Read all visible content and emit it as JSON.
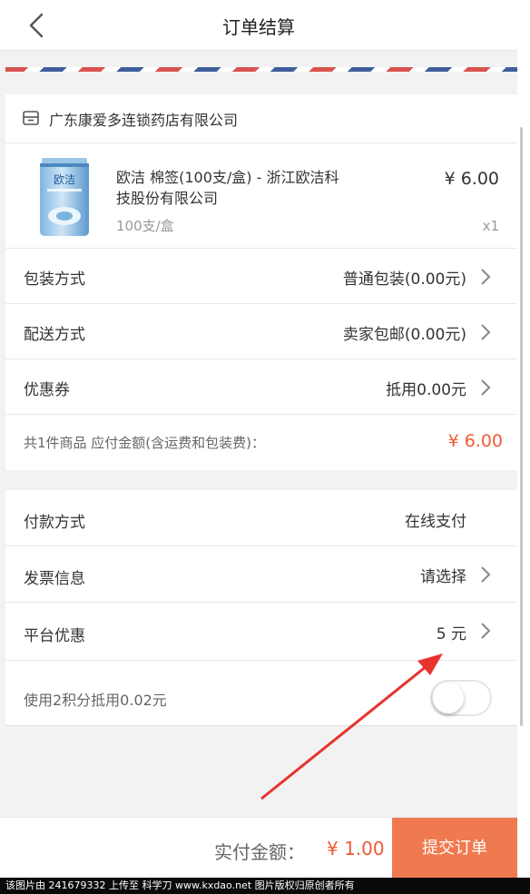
{
  "header": {
    "title": "订单结算"
  },
  "store": {
    "name": "广东康爱多连锁药店有限公司"
  },
  "product": {
    "name": "欧洁 棉签(100支/盒) - 浙江欧洁科技股份有限公司",
    "name_line1": "欧洁 棉签(100支/盒) - 浙江欧洁科",
    "name_line2": "技股份有限公司",
    "spec": "100支/盒",
    "price": "¥ 6.00",
    "qty": "x1",
    "image_text": "欧洁"
  },
  "options": [
    {
      "label": "包装方式",
      "value": "普通包装(0.00元)"
    },
    {
      "label": "配送方式",
      "value": "卖家包邮(0.00元)"
    },
    {
      "label": "优惠券",
      "value": "抵用0.00元"
    }
  ],
  "summary": {
    "text": "共1件商品 应付金额(含运费和包装费)：",
    "amount": "¥ 6.00"
  },
  "payment": [
    {
      "label": "付款方式",
      "value": "在线支付"
    },
    {
      "label": "发票信息",
      "value": "请选择"
    },
    {
      "label": "平台优惠",
      "value": "5 元"
    }
  ],
  "points": {
    "label": "使用2积分抵用0.02元",
    "enabled": false
  },
  "footer": {
    "pay_label": "实付金额：",
    "pay_amount": "¥ 1.00",
    "submit_label": "提交订单"
  },
  "watermark": "该图片由 241679332 上传至 科学刀 www.kxdao.net 图片版权归原创者所有",
  "colors": {
    "accent": "#ee5c35",
    "button": "#f07a50",
    "annotation": "#e8322d"
  }
}
